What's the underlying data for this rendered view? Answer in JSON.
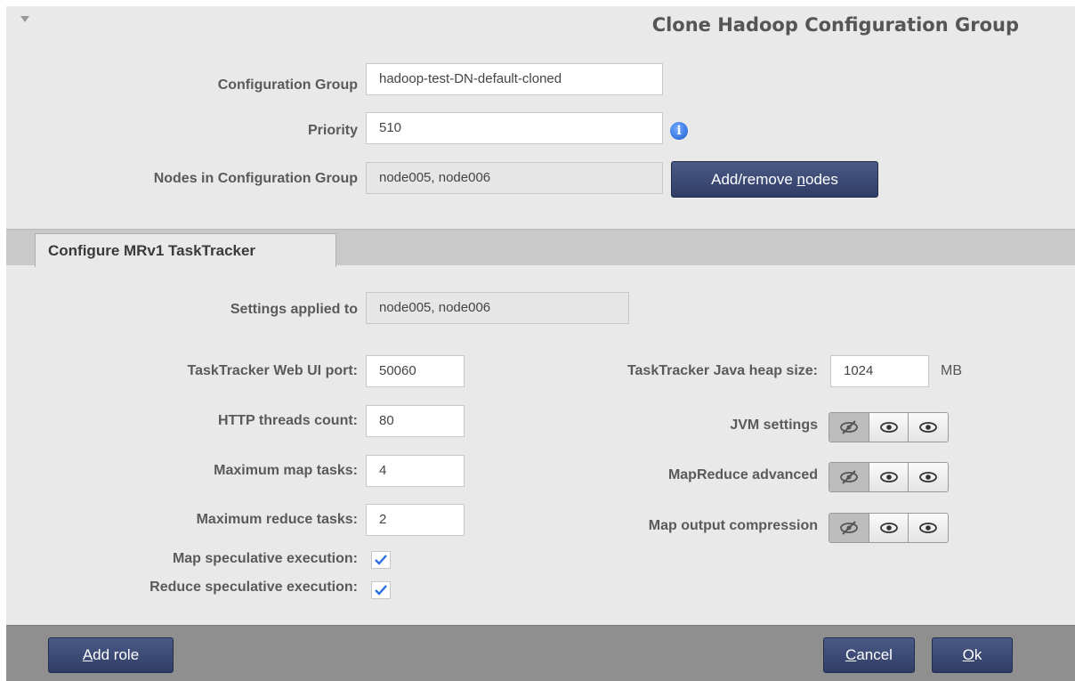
{
  "dialog": {
    "title": "Clone Hadoop Configuration Group"
  },
  "group": {
    "config_group_label": "Configuration Group",
    "config_group_value": "hadoop-test-DN-default-cloned",
    "priority_label": "Priority",
    "priority_value": "510",
    "nodes_label": "Nodes in Configuration Group",
    "nodes_value": "node005, node006",
    "add_remove_button": {
      "prefix": "Add/remove ",
      "underlined": "n",
      "suffix": "odes"
    }
  },
  "tab": {
    "label": "Configure MRv1 TaskTracker"
  },
  "settings": {
    "applied_to_label": "Settings applied to",
    "applied_to_value": "node005, node006",
    "web_ui_port_label": "TaskTracker Web UI port:",
    "web_ui_port_value": "50060",
    "http_threads_label": "HTTP threads count:",
    "http_threads_value": "80",
    "max_map_label": "Maximum map tasks:",
    "max_map_value": "4",
    "max_reduce_label": "Maximum reduce tasks:",
    "max_reduce_value": "2",
    "map_spec_label": "Map speculative execution:",
    "map_spec_checked": true,
    "reduce_spec_label": "Reduce speculative execution:",
    "reduce_spec_checked": true,
    "heap_label": "TaskTracker Java heap size:",
    "heap_value": "1024",
    "heap_unit": "MB",
    "jvm_label": "JVM settings",
    "mr_adv_label": "MapReduce advanced",
    "map_out_label": "Map output compression"
  },
  "footer": {
    "add_role": {
      "underlined": "A",
      "rest": "dd role"
    },
    "cancel": {
      "underlined": "C",
      "rest": "ancel"
    },
    "ok": {
      "underlined": "O",
      "rest": "k"
    }
  },
  "icons": {
    "collapse": "triangle-down-icon",
    "info": "info-icon",
    "eye_hidden": "eye-slash-icon",
    "eye": "eye-icon",
    "check": "checkmark-icon"
  },
  "colors": {
    "dialog_bg": "#e9e9e9",
    "accent_button": "#3a4874",
    "footer_bg": "#8f8f8f",
    "info_blue": "#2a6de0",
    "check_blue": "#2a6de0"
  }
}
